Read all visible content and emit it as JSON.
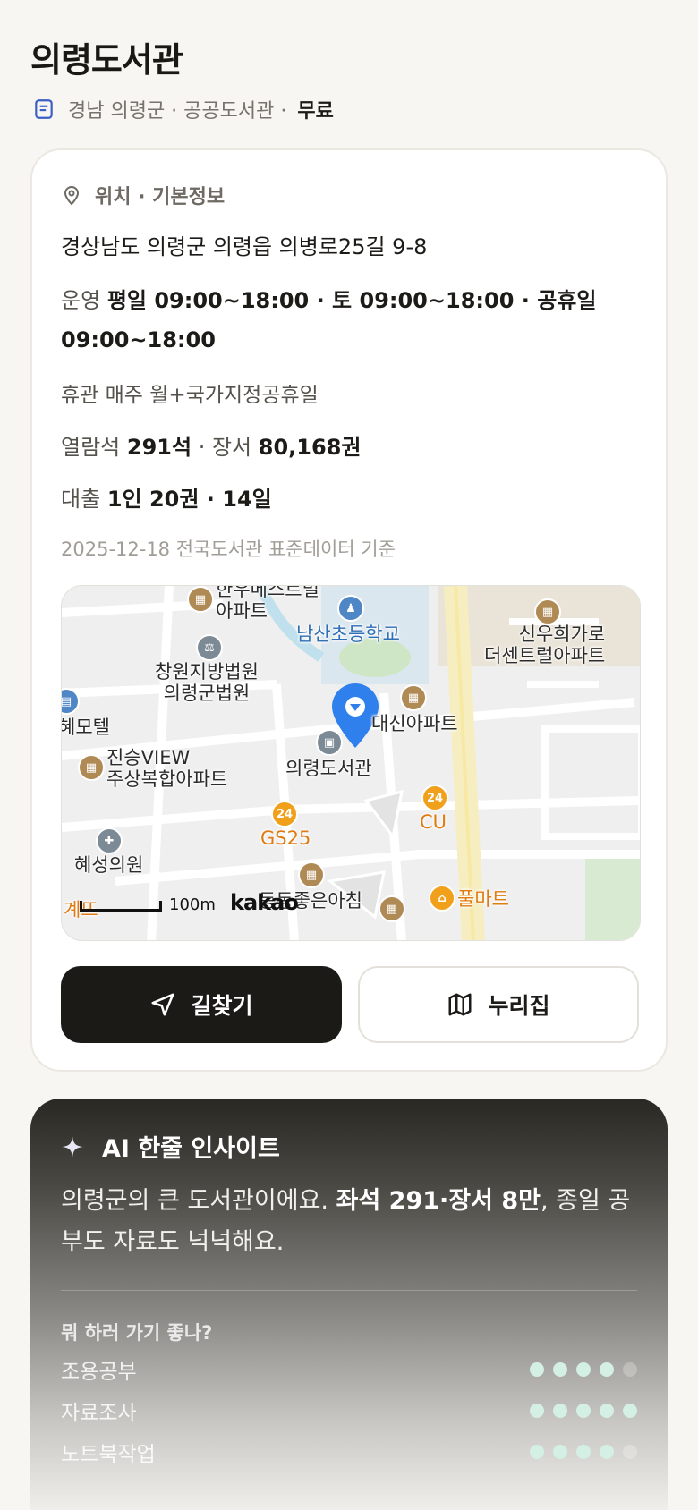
{
  "title": "의령도서관",
  "subtitle": {
    "meta": "경남 의령군 · 공공도서관 ·",
    "fee": "무료"
  },
  "info": {
    "section_title": "위치 · 기본정보",
    "address": "경상남도 의령군 의령읍 의병로25길 9-8",
    "hours_label": "운영",
    "hours_value": "평일 09:00~18:00 · 토 09:00~18:00 · 공휴일 09:00~18:00",
    "closed": "휴관 매주 월+국가지정공휴일",
    "seats_label": "열람석",
    "seats_value": "291석",
    "books_label": "· 장서",
    "books_value": "80,168권",
    "loan_label": "대출",
    "loan_value": "1인 20권 · 14일",
    "source": "2025-12-18 전국도서관 표준데이터 기준"
  },
  "map": {
    "labels": {
      "apt1": "한우메스트빌\n아파트",
      "school": "남산초등학교",
      "court": "창원지방법원\n의령군법원",
      "apt_shinwoo": "신우희가로\n더센트럴아파트",
      "motel": "혜모텔",
      "daeshin": "대신아파트",
      "jinseung": "진승VIEW\n주상복합아파트",
      "library": "의령도서관",
      "cu": "CU",
      "gs25": "GS25",
      "clinic": "혜성의원",
      "dongdong": "동동좋은아침",
      "pulmart": "풀마트",
      "cut": "계뜨"
    },
    "scale": "100m",
    "brand": "kakao"
  },
  "buttons": {
    "directions": "길찾기",
    "homepage": "누리집"
  },
  "ai": {
    "title": "AI 한줄 인사이트",
    "text_a": "의령군의 큰 도서관이에요. ",
    "text_b": "좌석 291·장서 8만",
    "text_c": ", 종일 공부도 자료도 넉넉해요.",
    "question": "뭐 하러 가기 좋나?",
    "ratings": [
      {
        "label": "조용공부",
        "score": 4,
        "max": 5
      },
      {
        "label": "자료조사",
        "score": 5,
        "max": 5
      },
      {
        "label": "노트북작업",
        "score": 4,
        "max": 5
      }
    ]
  }
}
